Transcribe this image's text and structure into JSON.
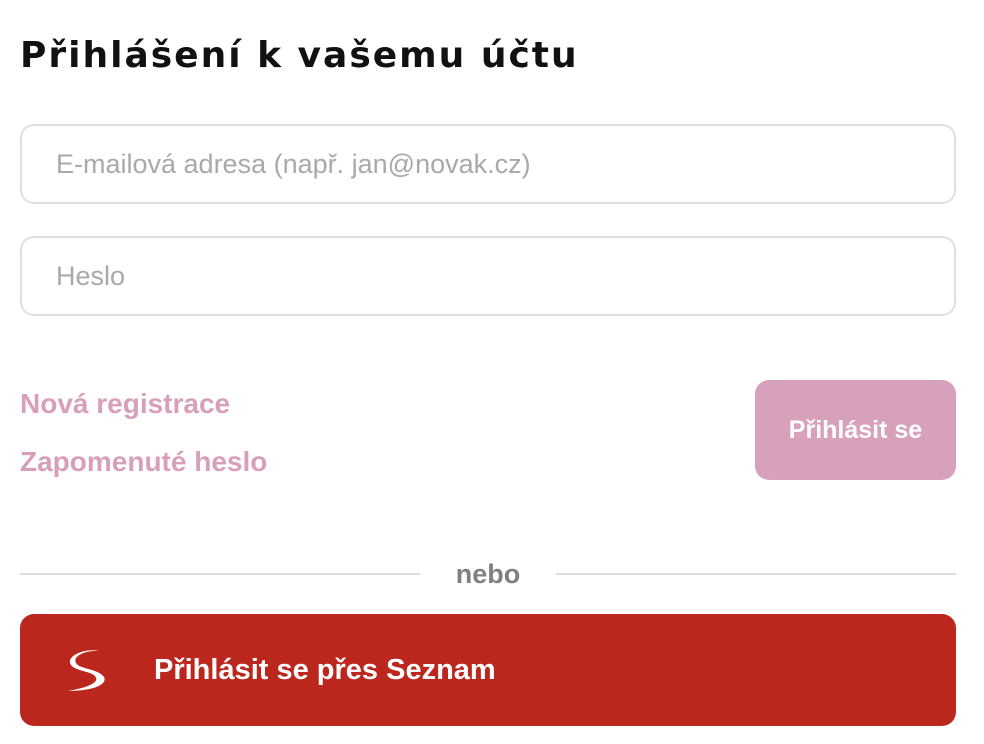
{
  "login": {
    "title": "Přihlášení k vašemu účtu",
    "email_placeholder": "E-mailová adresa (např. jan@novak.cz)",
    "email_value": "",
    "password_placeholder": "Heslo",
    "password_value": "",
    "register_label": "Nová registrace",
    "forgot_label": "Zapomenuté heslo",
    "submit_label": "Přihlásit se",
    "divider_label": "nebo",
    "seznam_label": "Přihlásit se přes Seznam",
    "seznam_icon": "seznam-logo-icon"
  },
  "colors": {
    "link": "#d79fba",
    "submit_bg": "#d7a0bb",
    "seznam_bg": "#bb261d",
    "border": "#e0e0e0",
    "placeholder": "#a9a9a9"
  }
}
